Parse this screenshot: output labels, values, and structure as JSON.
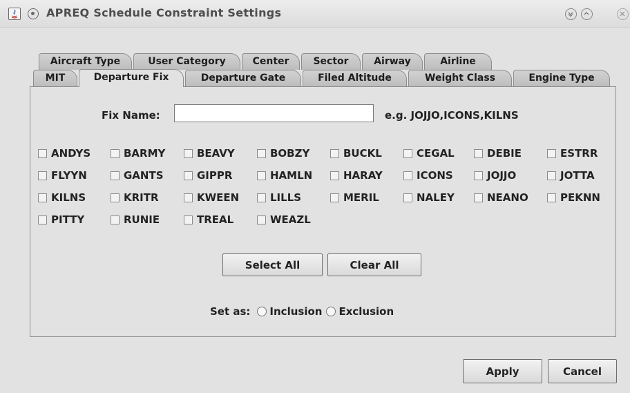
{
  "window": {
    "title": "APREQ Schedule Constraint Settings"
  },
  "icons": {
    "app": "java-app-icon",
    "menu": "window-menu-icon",
    "minimize": "minimize-icon",
    "maximize": "maximize-icon",
    "close": "close-icon"
  },
  "tabs": {
    "back_row": [
      "Aircraft Type",
      "User Category",
      "Center",
      "Sector",
      "Airway",
      "Airline"
    ],
    "front_row": [
      "MIT",
      "Departure Fix",
      "Departure Gate",
      "Filed Altitude",
      "Weight Class",
      "Engine Type"
    ],
    "selected": "Departure Fix"
  },
  "fix": {
    "label": "Fix Name:",
    "value": "",
    "placeholder": "",
    "example": "e.g. JOJJO,ICONS,KILNS"
  },
  "fixes": [
    "ANDYS",
    "BARMY",
    "BEAVY",
    "BOBZY",
    "BUCKL",
    "CEGAL",
    "DEBIE",
    "ESTRR",
    "FLYYN",
    "GANTS",
    "GIPPR",
    "HAMLN",
    "HARAY",
    "ICONS",
    "JOJJO",
    "JOTTA",
    "KILNS",
    "KRITR",
    "KWEEN",
    "LILLS",
    "MERIL",
    "NALEY",
    "NEANO",
    "PEKNN",
    "PITTY",
    "RUNIE",
    "TREAL",
    "WEAZL"
  ],
  "buttons": {
    "select_all": "Select All",
    "clear_all": "Clear All",
    "apply": "Apply",
    "cancel": "Cancel"
  },
  "set_as": {
    "label": "Set as:",
    "inclusion": "Inclusion",
    "exclusion": "Exclusion"
  }
}
